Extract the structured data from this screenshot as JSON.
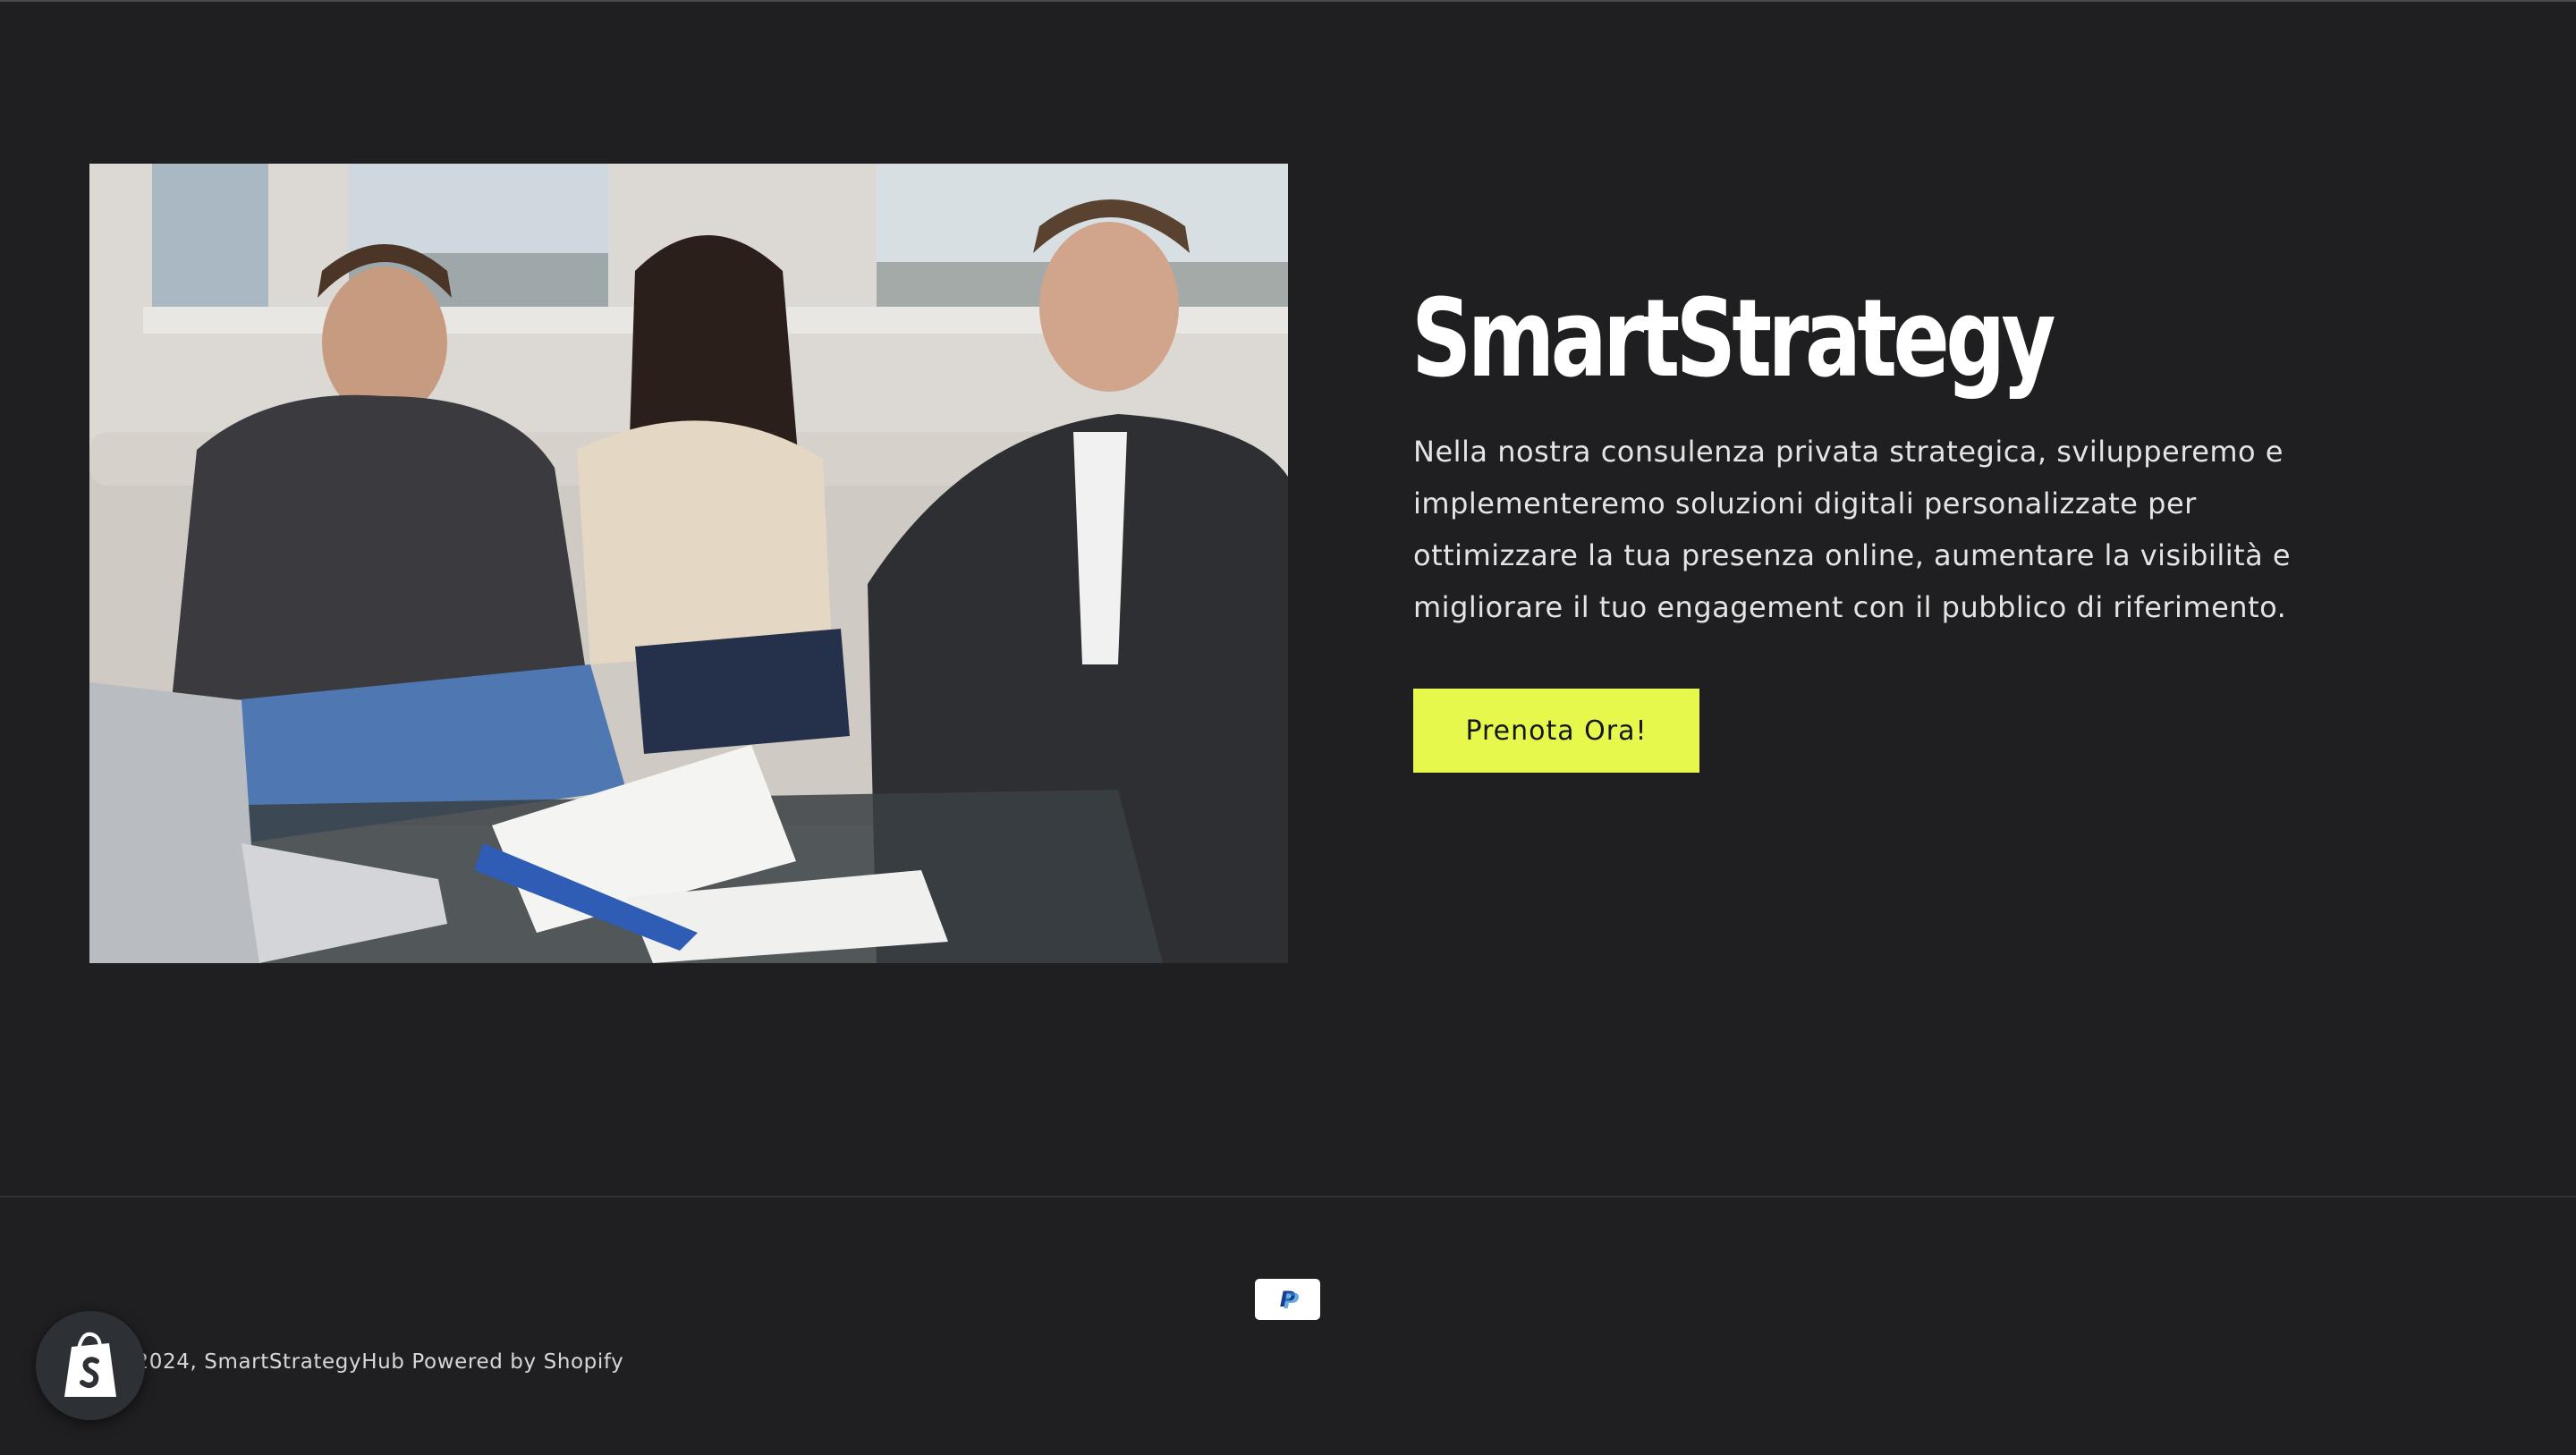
{
  "hero": {
    "title": "SmartStrategy",
    "description": "Nella nostra consulenza privata strategica, svilupperemo e implementeremo soluzioni digitali personalizzate per ottimizzare la tua presenza online, aumentare la visibilità e migliorare il tuo engagement con il pubblico di riferimento.",
    "cta_label": "Prenota Ora!",
    "image_icon": "consultation-photo"
  },
  "footer": {
    "payment_icon": "paypal-icon",
    "payment_letter": "P",
    "copyright_prefix": "© 2024, ",
    "store_name": "SmartStrategyHub",
    "powered_by": "Powered by Shopify",
    "badge_icon": "shopify-bag-icon"
  },
  "colors": {
    "background": "#1f1f21",
    "accent": "#e7f84d",
    "title": "#ffffff",
    "text": "#e4e4e4"
  }
}
